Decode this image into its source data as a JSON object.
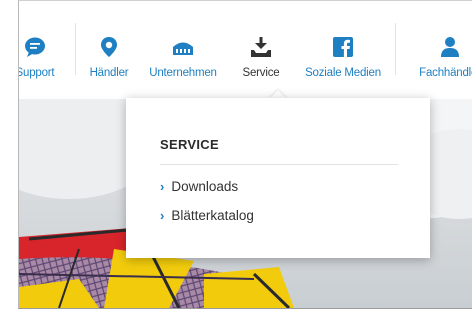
{
  "nav": {
    "items": [
      {
        "label": "Support",
        "icon": "speech-bubble-icon"
      },
      {
        "label": "Händler",
        "icon": "map-pin-icon"
      },
      {
        "label": "Unternehmen",
        "icon": "building-icon"
      },
      {
        "label": "Service",
        "icon": "service-tray-icon",
        "active": true
      },
      {
        "label": "Soziale Medien",
        "icon": "facebook-icon"
      },
      {
        "label": "Fachhändler",
        "icon": "person-icon"
      }
    ]
  },
  "dropdown": {
    "title": "SERVICE",
    "links": [
      {
        "label": "Downloads"
      },
      {
        "label": "Blätterkatalog"
      }
    ]
  },
  "colors": {
    "accent": "#1e7fc2",
    "active_text": "#333333",
    "kite_red": "#d8252b",
    "kite_yellow": "#f2cc0c",
    "kite_purple": "#6b4f8a"
  }
}
